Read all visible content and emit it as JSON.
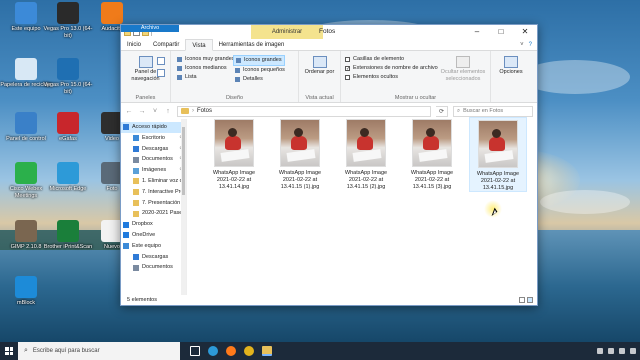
{
  "desktop": {
    "icons": [
      {
        "label": "Este equipo",
        "name": "this-pc",
        "color": "#3c8ad8"
      },
      {
        "label": "Vegas Pro 13.0 (64-bit)",
        "name": "vegas-pro-13",
        "color": "#2a2a2a"
      },
      {
        "label": "Audacity",
        "name": "audacity",
        "color": "#f07b1a"
      },
      {
        "label": "Papelera de reciclaje",
        "name": "recycle-bin",
        "color": "#d8e8f5"
      },
      {
        "label": "Vegas Pro 15.0 (64-bit)",
        "name": "vegas-pro-15",
        "color": "#1f6fb2"
      },
      {
        "label": "Panel de control",
        "name": "control-panel",
        "color": "#3a80c8"
      },
      {
        "label": "eGafas",
        "name": "egafas",
        "color": "#c8262c"
      },
      {
        "label": "Video",
        "name": "video",
        "color": "#2e2e2e"
      },
      {
        "label": "Cisco Webex Meetings",
        "name": "webex",
        "color": "#2bb04b"
      },
      {
        "label": "Microsoft Edge",
        "name": "edge",
        "color": "#2d9ad8"
      },
      {
        "label": "Foto",
        "name": "foto",
        "color": "#5a6a78"
      },
      {
        "label": "GIMP 2.10.8",
        "name": "gimp",
        "color": "#7a6650"
      },
      {
        "label": "Brother iPrint&Scan",
        "name": "brother-iprint",
        "color": "#1a7f3a"
      },
      {
        "label": "Nuevo",
        "name": "nuevo",
        "color": "#f2f2f2"
      },
      {
        "label": "mBlock",
        "name": "mblock",
        "color": "#1d8bd8"
      }
    ]
  },
  "explorer": {
    "context_tab": "Administrar",
    "title": "Fotos",
    "tabs": [
      "Archivo",
      "Inicio",
      "Compartir",
      "Vista",
      "Herramientas de imagen"
    ],
    "ribbon": {
      "nav_pane_label": "Panel de navegación",
      "groups": [
        "Paneles",
        "Diseño",
        "Vista actual",
        "Mostrar u ocultar"
      ],
      "layout_col1": [
        "Iconos muy grandes",
        "Iconos medianos",
        "Lista"
      ],
      "layout_col2": [
        "Iconos grandes",
        "Iconos pequeños",
        "Detalles"
      ],
      "sort_label": "Ordenar por",
      "checkboxes": [
        {
          "label": "Casillas de elemento",
          "checked": false
        },
        {
          "label": "Extensiones de nombre de archivo",
          "checked": true
        },
        {
          "label": "Elementos ocultos",
          "checked": false
        }
      ],
      "hide_selected": "Ocultar elementos seleccionados",
      "options": "Opciones"
    },
    "address": {
      "path": "Fotos",
      "search_placeholder": "Buscar en Fotos"
    },
    "nav_pane": {
      "items": [
        {
          "label": "Acceso rápido",
          "kind": "star",
          "indent": false,
          "selected": true
        },
        {
          "label": "Escritorio",
          "kind": "desktop",
          "indent": true,
          "pinned": true
        },
        {
          "label": "Descargas",
          "kind": "download",
          "indent": true,
          "pinned": true
        },
        {
          "label": "Documentos",
          "kind": "doc",
          "indent": true,
          "pinned": true
        },
        {
          "label": "Imágenes",
          "kind": "pictures",
          "indent": true,
          "pinned": true
        },
        {
          "label": "1. Eliminar voz c",
          "kind": "folder",
          "indent": true
        },
        {
          "label": "7. Interactive Pre",
          "kind": "folder",
          "indent": true
        },
        {
          "label": "7. Presentación",
          "kind": "folder",
          "indent": true
        },
        {
          "label": "2020-2021 Pase",
          "kind": "folder",
          "indent": true
        },
        {
          "label": "Dropbox",
          "kind": "dropbox",
          "indent": false
        },
        {
          "label": "OneDrive",
          "kind": "onedrive",
          "indent": false
        },
        {
          "label": "Este equipo",
          "kind": "pc",
          "indent": false
        },
        {
          "label": "Descargas",
          "kind": "download",
          "indent": true
        },
        {
          "label": "Documentos",
          "kind": "doc",
          "indent": true
        }
      ]
    },
    "files": [
      {
        "line1": "WhatsApp Image",
        "line2": "2021-02-22 at",
        "line3": "13.41.14.jpg"
      },
      {
        "line1": "WhatsApp Image",
        "line2": "2021-02-22 at",
        "line3": "13.41.15 (1).jpg"
      },
      {
        "line1": "WhatsApp Image",
        "line2": "2021-02-22 at",
        "line3": "13.41.15 (2).jpg"
      },
      {
        "line1": "WhatsApp Image",
        "line2": "2021-02-22 at",
        "line3": "13.41.15 (3).jpg"
      },
      {
        "line1": "WhatsApp Image",
        "line2": "2021-02-22 at",
        "line3": "13.41.15.jpg"
      }
    ],
    "status": "5 elementos"
  },
  "taskbar": {
    "search_placeholder": "Escribe aquí para buscar",
    "apps": [
      {
        "name": "task-view-icon",
        "color": "#ffffff"
      },
      {
        "name": "edge-icon",
        "color": "#2d9ad8"
      },
      {
        "name": "firefox-icon",
        "color": "#ff7a1a"
      },
      {
        "name": "chrome-icon",
        "color": "#e3b31d"
      },
      {
        "name": "file-explorer-icon",
        "color": "#e8c05a"
      }
    ]
  }
}
